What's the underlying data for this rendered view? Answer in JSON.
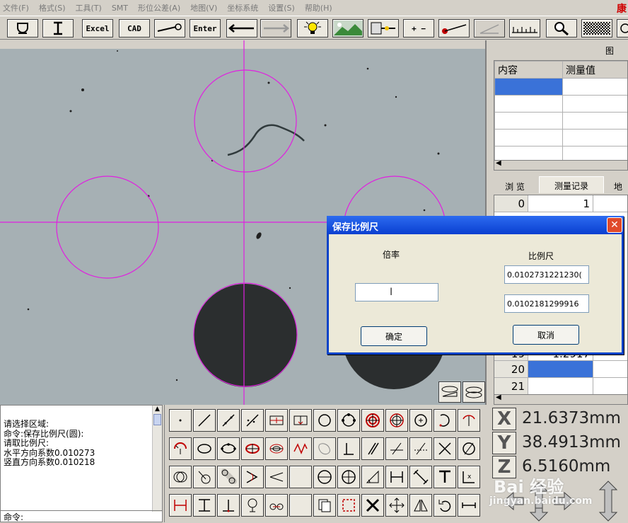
{
  "menu": [
    "文件(F)",
    "格式(S)",
    "工具(T)",
    "SMT",
    "形位公差(A)",
    "地图(V)",
    "坐标系统",
    "设置(S)",
    "帮助(H)"
  ],
  "brand_glyph": "康",
  "toolbar": {
    "excel_label": "Excel",
    "cad_label": "CAD",
    "enter_label": "Enter",
    "plus_minus_label": "+ −"
  },
  "rpanel": {
    "title": "图",
    "grid_headers": [
      "内容",
      "测量值"
    ],
    "tabs": [
      "浏 览",
      "测量记录",
      "地"
    ],
    "records": [
      {
        "index": "0",
        "value": "1"
      },
      {
        "index": "19",
        "value": "1.2917"
      },
      {
        "index": "20",
        "value": ""
      },
      {
        "index": "21",
        "value": ""
      }
    ]
  },
  "dialog": {
    "title": "保存比例尺",
    "magnification_label": "倍率",
    "scale_label": "比例尺",
    "magnification_value": "",
    "scale_h": "0.0102731221230(",
    "scale_v": "0.0102181299916",
    "ok_label": "确定",
    "cancel_label": "取消"
  },
  "log": {
    "lines": [
      "请选择区域:",
      "命令:保存比例尺(圆):",
      "请取比例尺:",
      "水平方向系数0.010273",
      "竖直方向系数0.010218"
    ],
    "prompt": "命令:"
  },
  "readout": {
    "x_label": "X",
    "y_label": "Y",
    "z_label": "Z",
    "x_value": "21.6373mm",
    "y_value": "38.4913mm",
    "z_value": "6.5160mm"
  },
  "watermark": {
    "text": "Bai 经验",
    "url": "jingyan.baidu.com"
  },
  "colors": {
    "overlay": "#e020e0",
    "titlebar": "#0a46d8",
    "selected_cell": "#3a72d8"
  }
}
